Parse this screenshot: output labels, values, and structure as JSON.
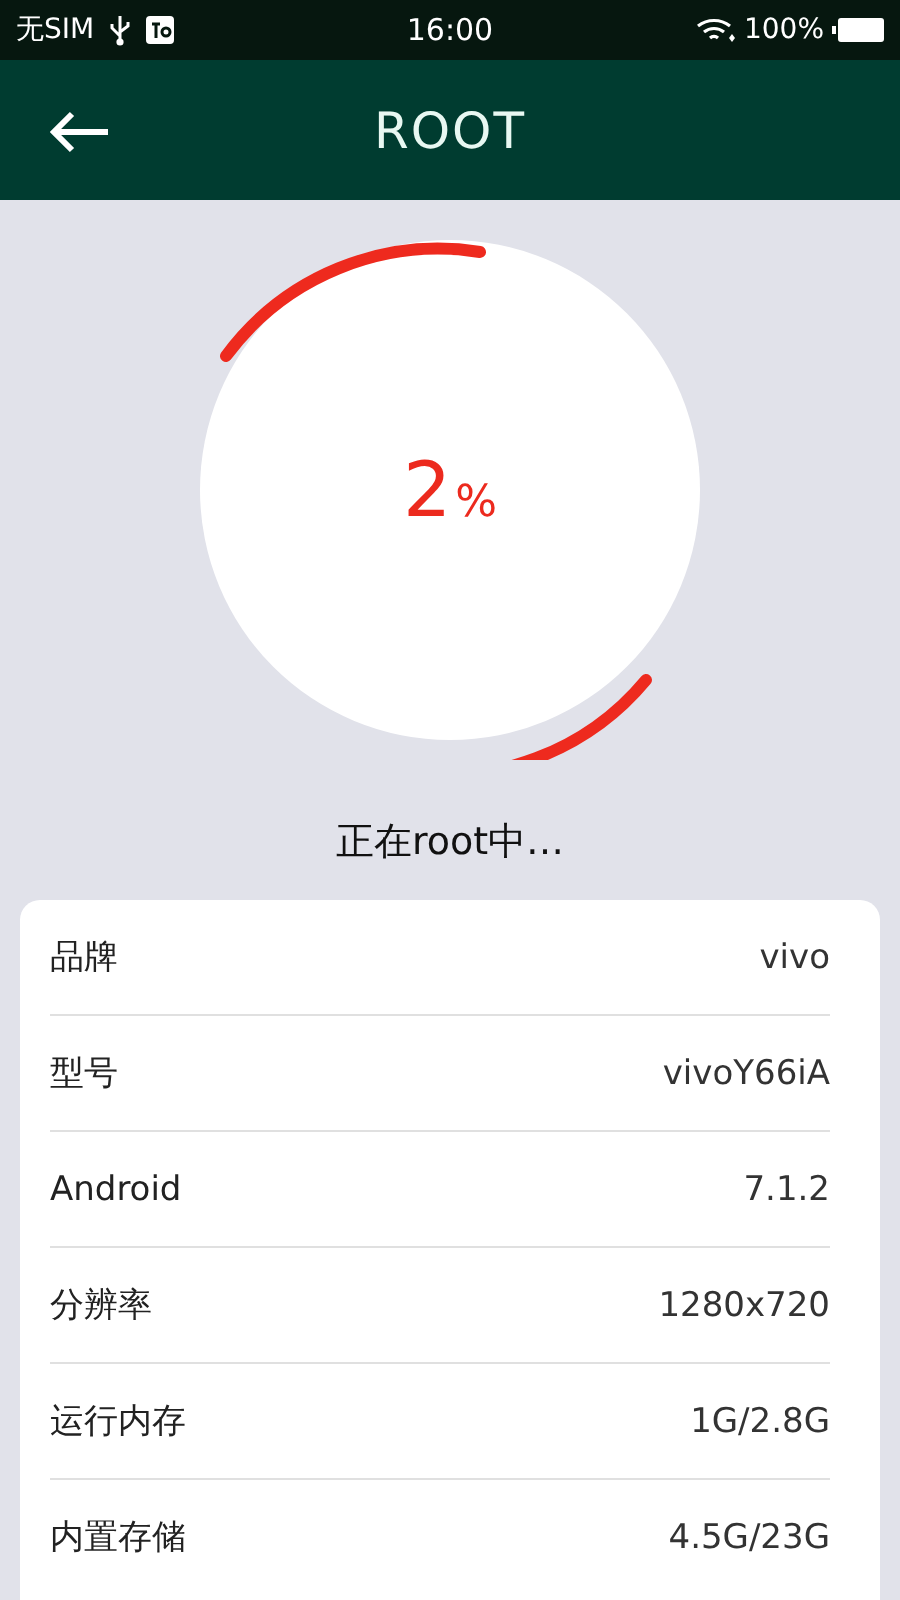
{
  "status_bar": {
    "carrier": "无SIM",
    "time": "16:00",
    "battery": "100%"
  },
  "app_bar": {
    "title": "ROOT"
  },
  "progress": {
    "value": "2",
    "unit": "%",
    "message": "正在root中…"
  },
  "info": [
    {
      "label": "品牌",
      "value": "vivo"
    },
    {
      "label": "型号",
      "value": "vivoY66iA"
    },
    {
      "label": "Android",
      "value": "7.1.2"
    },
    {
      "label": "分辨率",
      "value": "1280x720"
    },
    {
      "label": "运行内存",
      "value": "1G/2.8G"
    },
    {
      "label": "内置存储",
      "value": "4.5G/23G"
    }
  ]
}
